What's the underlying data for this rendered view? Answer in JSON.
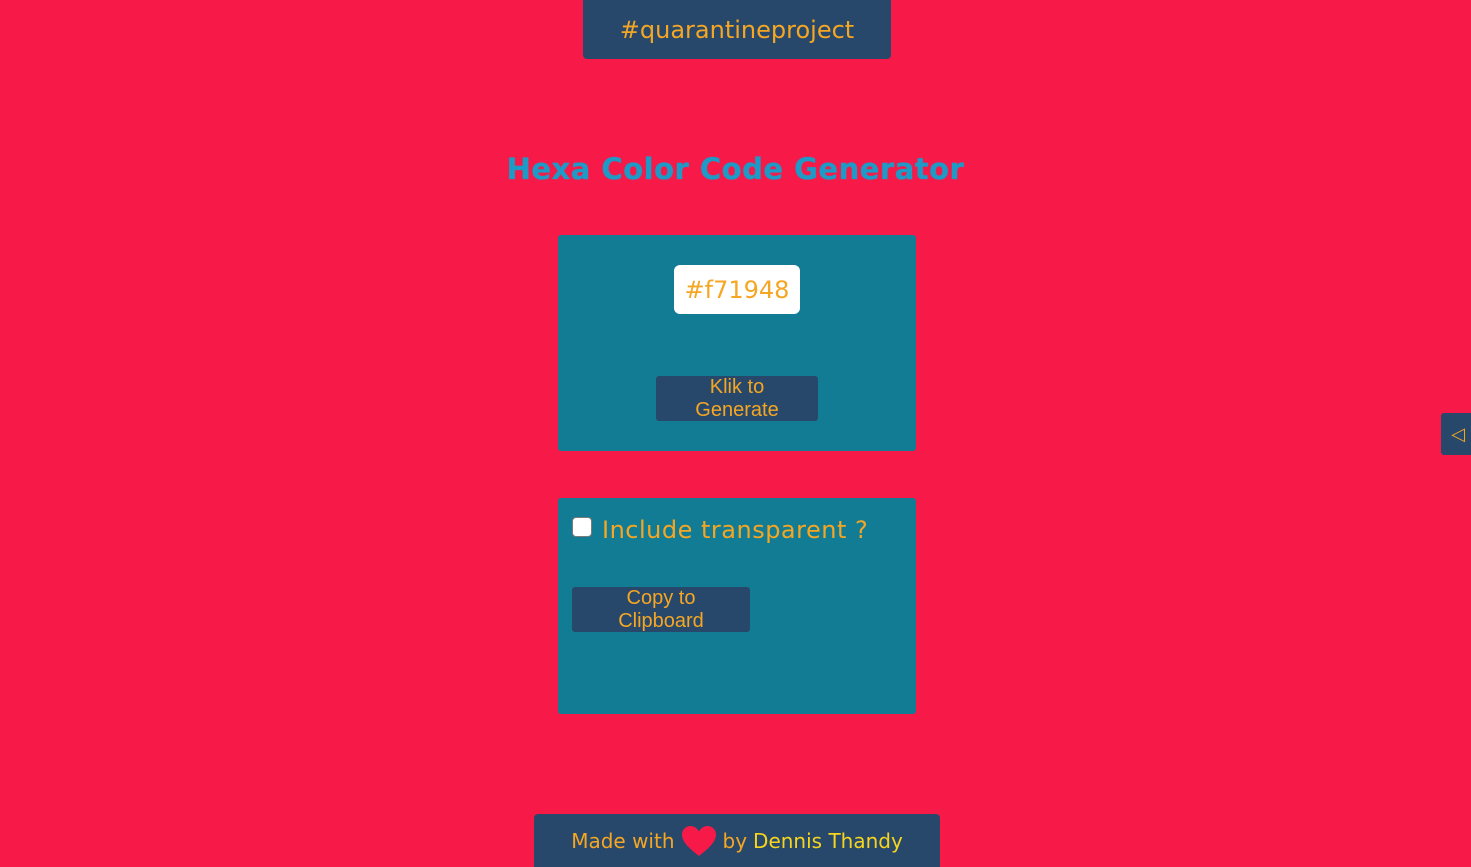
{
  "header": {
    "banner_text": "#quarantineproject"
  },
  "main": {
    "title": "Hexa Color Code Generator",
    "generator": {
      "hex_value": "#f71948",
      "generate_label": "Klik to Generate"
    },
    "options": {
      "include_transparent_label": "Include transparent ?",
      "include_transparent_checked": false,
      "copy_label": "Copy to Clipboard"
    }
  },
  "side_toggle": {
    "glyph": "◁",
    "icon": "triangle-left-icon"
  },
  "footer": {
    "made_with": "Made with",
    "heart_icon": "heart-icon",
    "by": "by",
    "author": "Dennis Thandy"
  },
  "colors": {
    "background": "#f71948",
    "panel": "#127c94",
    "dark": "#28486b",
    "accent_text": "#f5a623",
    "title": "#1d9bc6",
    "author": "#f7d51d"
  }
}
